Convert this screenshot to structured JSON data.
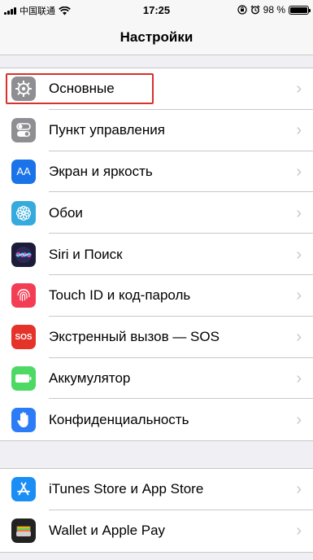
{
  "status_bar": {
    "carrier": "中国联通",
    "time": "17:25",
    "battery": "98 %",
    "battery_level": 0.98
  },
  "header": {
    "title": "Настройки"
  },
  "groups": [
    {
      "items": [
        {
          "label": "Основные",
          "icon": "gear-icon",
          "color": "#8e8e93"
        },
        {
          "label": "Пункт управления",
          "icon": "switches-icon",
          "color": "#8e8e93"
        },
        {
          "label": "Экран и яркость",
          "icon": "text-size-icon",
          "color": "#1a73e8"
        },
        {
          "label": "Обои",
          "icon": "flower-icon",
          "color": "#35aadc"
        },
        {
          "label": "Siri и Поиск",
          "icon": "siri-icon",
          "color": "#222"
        },
        {
          "label": "Touch ID и код-пароль",
          "icon": "fingerprint-icon",
          "color": "#f23d55"
        },
        {
          "label": "Экстренный вызов — SOS",
          "icon": "sos-icon",
          "color": "#e5332a"
        },
        {
          "label": "Аккумулятор",
          "icon": "battery-icon",
          "color": "#4cd964"
        },
        {
          "label": "Конфиденциальность",
          "icon": "hand-icon",
          "color": "#2b7cf6"
        }
      ]
    },
    {
      "items": [
        {
          "label": "iTunes Store и App Store",
          "icon": "app-store-icon",
          "color": "#1b8ef5"
        },
        {
          "label": "Wallet и Apple Pay",
          "icon": "wallet-icon",
          "color": "#222"
        }
      ]
    }
  ],
  "icons_text": {
    "text_size": "AA",
    "sos": "SOS"
  },
  "highlight_color": "#d9302c"
}
